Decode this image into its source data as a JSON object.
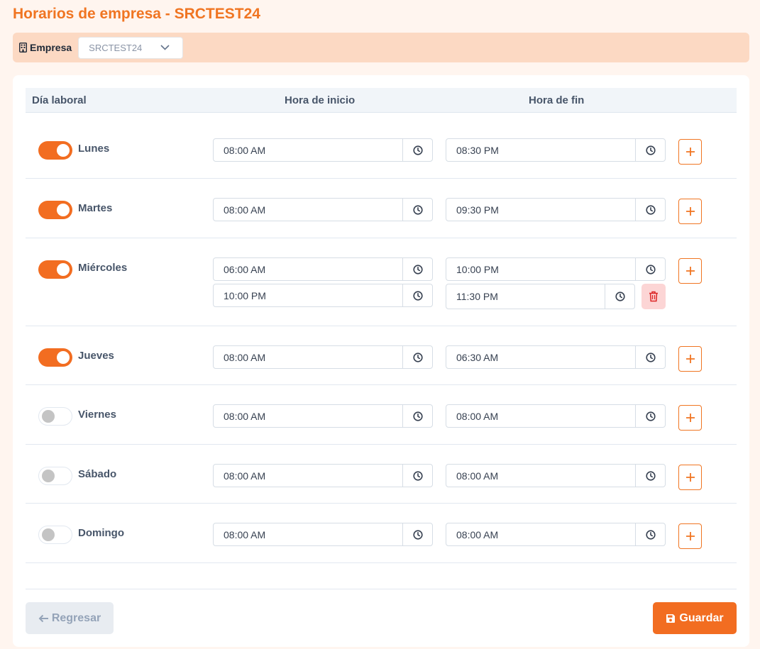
{
  "page": {
    "title": "Horarios de empresa - SRCTEST24"
  },
  "filter": {
    "label": "Empresa",
    "selected": "SRCTEST24"
  },
  "table": {
    "headers": {
      "day": "Día laboral",
      "start": "Hora de inicio",
      "end": "Hora de fin"
    },
    "days": [
      {
        "name": "Lunes",
        "enabled": true,
        "slots": [
          {
            "start": "08:00 AM",
            "end": "08:30 PM"
          }
        ]
      },
      {
        "name": "Martes",
        "enabled": true,
        "slots": [
          {
            "start": "08:00 AM",
            "end": "09:30 PM"
          }
        ]
      },
      {
        "name": "Miércoles",
        "enabled": true,
        "slots": [
          {
            "start": "06:00 AM",
            "end": "10:00 PM"
          },
          {
            "start": "10:00 PM",
            "end": "11:30 PM"
          }
        ]
      },
      {
        "name": "Jueves",
        "enabled": true,
        "slots": [
          {
            "start": "08:00 AM",
            "end": "06:30 AM"
          }
        ]
      },
      {
        "name": "Viernes",
        "enabled": false,
        "slots": [
          {
            "start": "08:00 AM",
            "end": "08:00 AM"
          }
        ]
      },
      {
        "name": "Sábado",
        "enabled": false,
        "slots": [
          {
            "start": "08:00 AM",
            "end": "08:00 AM"
          }
        ]
      },
      {
        "name": "Domingo",
        "enabled": false,
        "slots": [
          {
            "start": "08:00 AM",
            "end": "08:00 AM"
          }
        ]
      }
    ]
  },
  "actions": {
    "back_label": "Regresar",
    "save_label": "Guardar"
  },
  "colors": {
    "accent": "#f26d21",
    "danger": "#dc2626"
  },
  "icons": {
    "clock": "clock-icon",
    "add": "plus-icon",
    "delete": "trash-icon",
    "back": "arrow-left-icon",
    "save": "floppy-disk-icon",
    "company": "building-icon"
  }
}
